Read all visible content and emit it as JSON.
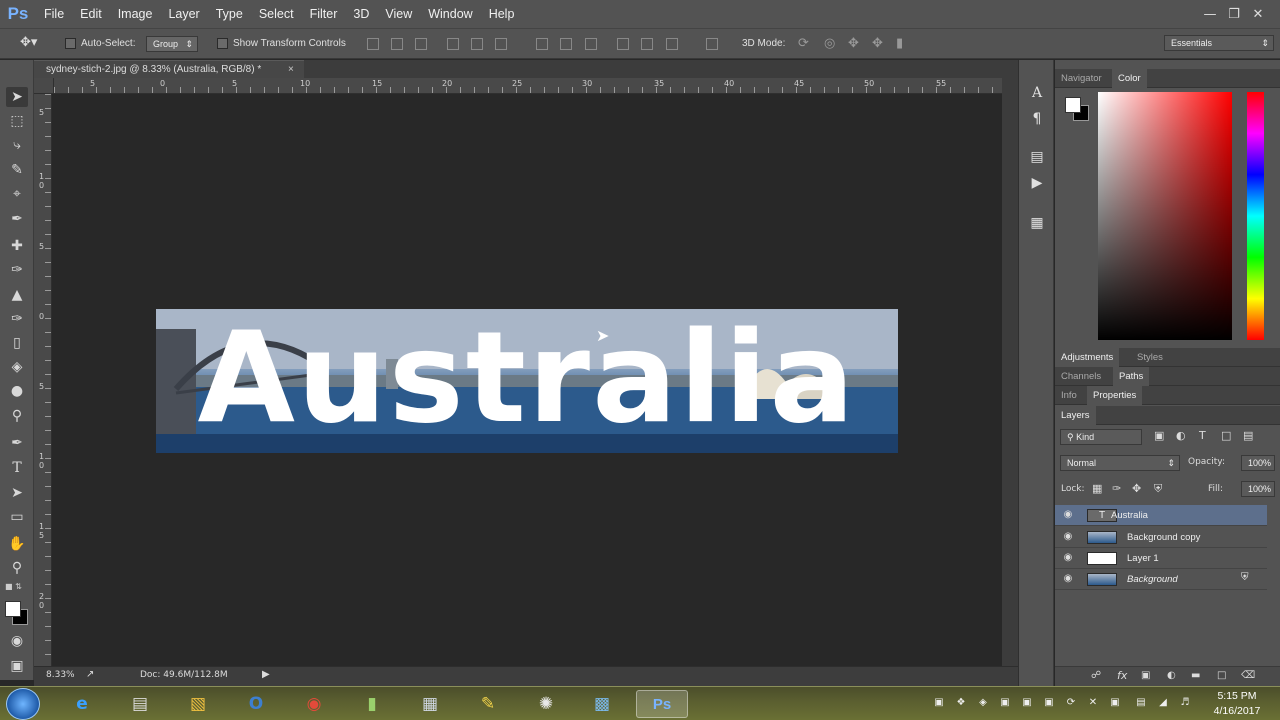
{
  "app": {
    "logo": "Ps"
  },
  "menu": [
    "File",
    "Edit",
    "Image",
    "Layer",
    "Type",
    "Select",
    "Filter",
    "3D",
    "View",
    "Window",
    "Help"
  ],
  "options": {
    "auto_select_label": "Auto-Select:",
    "auto_select_value": "Group",
    "show_transform_label": "Show Transform Controls",
    "mode3d_label": "3D Mode:",
    "workspace": "Essentials"
  },
  "document": {
    "tab_title": "sydney-stich-2.jpg @ 8.33% (Australia, RGB/8) *",
    "close": "×"
  },
  "ruler_h": [
    "5",
    "0",
    "5",
    "10",
    "15",
    "20",
    "25",
    "30",
    "35",
    "40",
    "45",
    "50",
    "55"
  ],
  "ruler_v": [
    "5",
    "1 0",
    "5",
    "0",
    "5",
    "1 0",
    "1 5",
    "2 0"
  ],
  "canvas_text": "Australia",
  "status": {
    "zoom": "8.33%",
    "doc": "Doc: 49.6M/112.8M"
  },
  "panels": {
    "top_tabs": [
      "Navigator",
      "Color"
    ],
    "adj_tabs": [
      "Adjustments",
      "Styles"
    ],
    "channel_tabs": [
      "Channels",
      "Paths"
    ],
    "info_tabs": [
      "Info",
      "Properties"
    ],
    "layers_tab": "Layers"
  },
  "layers_panel": {
    "kind": "Kind",
    "blend_mode": "Normal",
    "opacity_label": "Opacity:",
    "opacity_value": "100%",
    "lock_label": "Lock:",
    "fill_label": "Fill:",
    "fill_value": "100%",
    "layers": [
      {
        "name": "Australia",
        "type": "text",
        "selected": true
      },
      {
        "name": "Background copy",
        "type": "image",
        "selected": false
      },
      {
        "name": "Layer 1",
        "type": "white",
        "selected": false
      },
      {
        "name": "Background",
        "type": "image",
        "selected": false,
        "locked": true
      }
    ]
  },
  "clock": {
    "time": "5:15 PM",
    "date": "4/16/2017"
  },
  "colors": {
    "accent": "#79b3ff",
    "selected_layer": "#5d6f8c"
  }
}
